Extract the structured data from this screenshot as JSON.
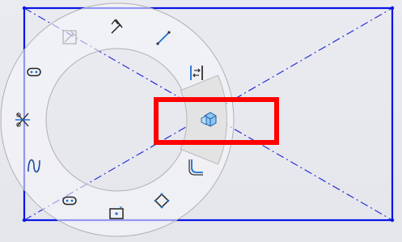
{
  "canvas": {
    "background": "#e8eaef",
    "sketch_color": "#0a14e6",
    "construction_color": "#2a30d8"
  },
  "sketch": {
    "entities": [
      {
        "kind": "rectangle",
        "style": "solid"
      },
      {
        "kind": "diagonal",
        "style": "centerline"
      },
      {
        "kind": "diagonal",
        "style": "centerline"
      }
    ]
  },
  "mouse_gesture_wheel": {
    "ring_color": "rgba(246,247,250,0.55)",
    "hover_segment_color": "#e3e3e3",
    "items": [
      {
        "id": "hover-toggle",
        "icon": "sketch-edit-icon"
      },
      {
        "id": "smart-dimension",
        "icon": "smart-dimension-icon"
      },
      {
        "id": "line",
        "icon": "line-icon"
      },
      {
        "id": "sketch-offset",
        "icon": "offset-entities-icon"
      },
      {
        "id": "part-view",
        "icon": "3d-cube-icon",
        "state": "hovered"
      },
      {
        "id": "fillet",
        "icon": "fillet-icon"
      },
      {
        "id": "polygon",
        "icon": "polygon-icon"
      },
      {
        "id": "center-rectangle",
        "icon": "center-rectangle-icon"
      },
      {
        "id": "straight-slot",
        "icon": "slot-icon"
      },
      {
        "id": "spline",
        "icon": "spline-icon"
      },
      {
        "id": "trim",
        "icon": "trim-entities-icon"
      },
      {
        "id": "centerpoint-slot",
        "icon": "centerpoint-slot-icon"
      }
    ]
  },
  "highlight": {
    "color": "#ff0000",
    "target": "part-view"
  }
}
